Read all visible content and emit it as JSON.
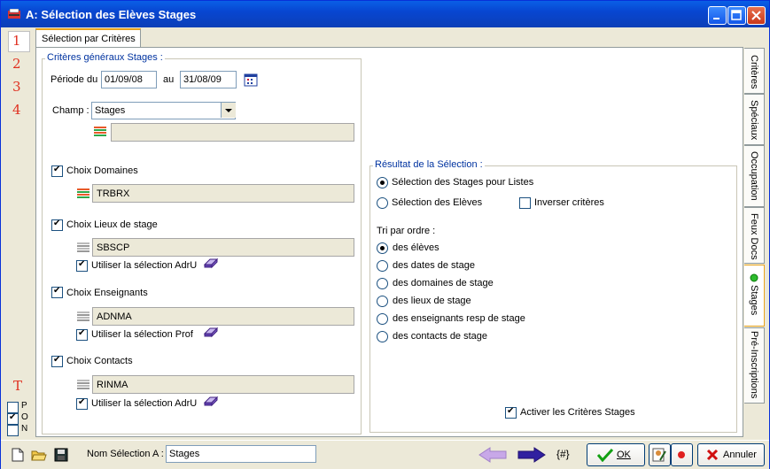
{
  "window": {
    "title": "A: Sélection des Elèves Stages"
  },
  "side_numbers": [
    "1",
    "2",
    "3",
    "4"
  ],
  "side_letters": {
    "t": "T",
    "p": "P",
    "o": "O",
    "n": "N"
  },
  "tab": {
    "label": "Sélection par Critères"
  },
  "criteria": {
    "title": "Critères généraux Stages :",
    "periode_label": "Période du",
    "date_from": "01/09/08",
    "au_label": "au",
    "date_to": "31/08/09",
    "champ_label": "Champ :",
    "champ_value": "Stages",
    "domaines": {
      "label": "Choix Domaines",
      "value": "TRBRX"
    },
    "lieux": {
      "label": "Choix Lieux de stage",
      "value": "SBSCP",
      "use_label": "Utiliser la sélection AdrU"
    },
    "enseignants": {
      "label": "Choix Enseignants",
      "value": "ADNMA",
      "use_label": "Utiliser la sélection Prof"
    },
    "contacts": {
      "label": "Choix Contacts",
      "value": "RINMA",
      "use_label": "Utiliser la sélection AdrU"
    }
  },
  "result": {
    "title": "Résultat de la Sélection :",
    "opt_stages": "Sélection des Stages pour Listes",
    "opt_eleves": "Sélection des Elèves",
    "inverser": "Inverser critères",
    "tri_label": "Tri par ordre :",
    "sort_options": [
      "des élèves",
      "des dates de stage",
      "des domaines de stage",
      "des lieux de stage",
      "des enseignants resp de stage",
      "des contacts de stage"
    ],
    "activer": "Activer les Critères Stages"
  },
  "vtabs": [
    "Critères",
    "Spéciaux",
    "Occupation",
    "Feux Docs",
    "Stages",
    "Pré-Inscriptions"
  ],
  "bottom": {
    "nom_label": "Nom Sélection A :",
    "nom_value": "Stages",
    "hash_label": "{#}",
    "ok_label": "OK",
    "annuler_label": "Annuler"
  },
  "colors": {
    "title_blue": "#0a5fe6",
    "group_title": "#0033a0",
    "red": "#e03020"
  }
}
